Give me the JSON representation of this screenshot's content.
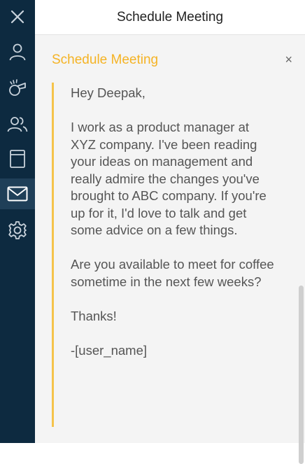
{
  "sidebar": {
    "items": [
      {
        "icon": "close-icon"
      },
      {
        "icon": "person-icon"
      },
      {
        "icon": "whistle-icon"
      },
      {
        "icon": "people-icon"
      },
      {
        "icon": "archive-icon"
      },
      {
        "icon": "mail-icon",
        "active": true
      },
      {
        "icon": "gear-icon"
      }
    ],
    "background": "#0d2a40",
    "active_background": "#1f3f58"
  },
  "header": {
    "title": "Schedule Meeting"
  },
  "panel": {
    "title": "Schedule Meeting",
    "close_label": "×",
    "accent_color": "#f5b324",
    "message": [
      "Hey Deepak,",
      "I work as a product manager at XYZ company. I've been reading your ideas on management and really admire the changes you've brought to ABC company. If you're up for it, I'd love to talk and get some advice on a few things.",
      "Are you available to meet for coffee sometime in the next few weeks?",
      "Thanks!",
      "-[user_name]"
    ]
  }
}
